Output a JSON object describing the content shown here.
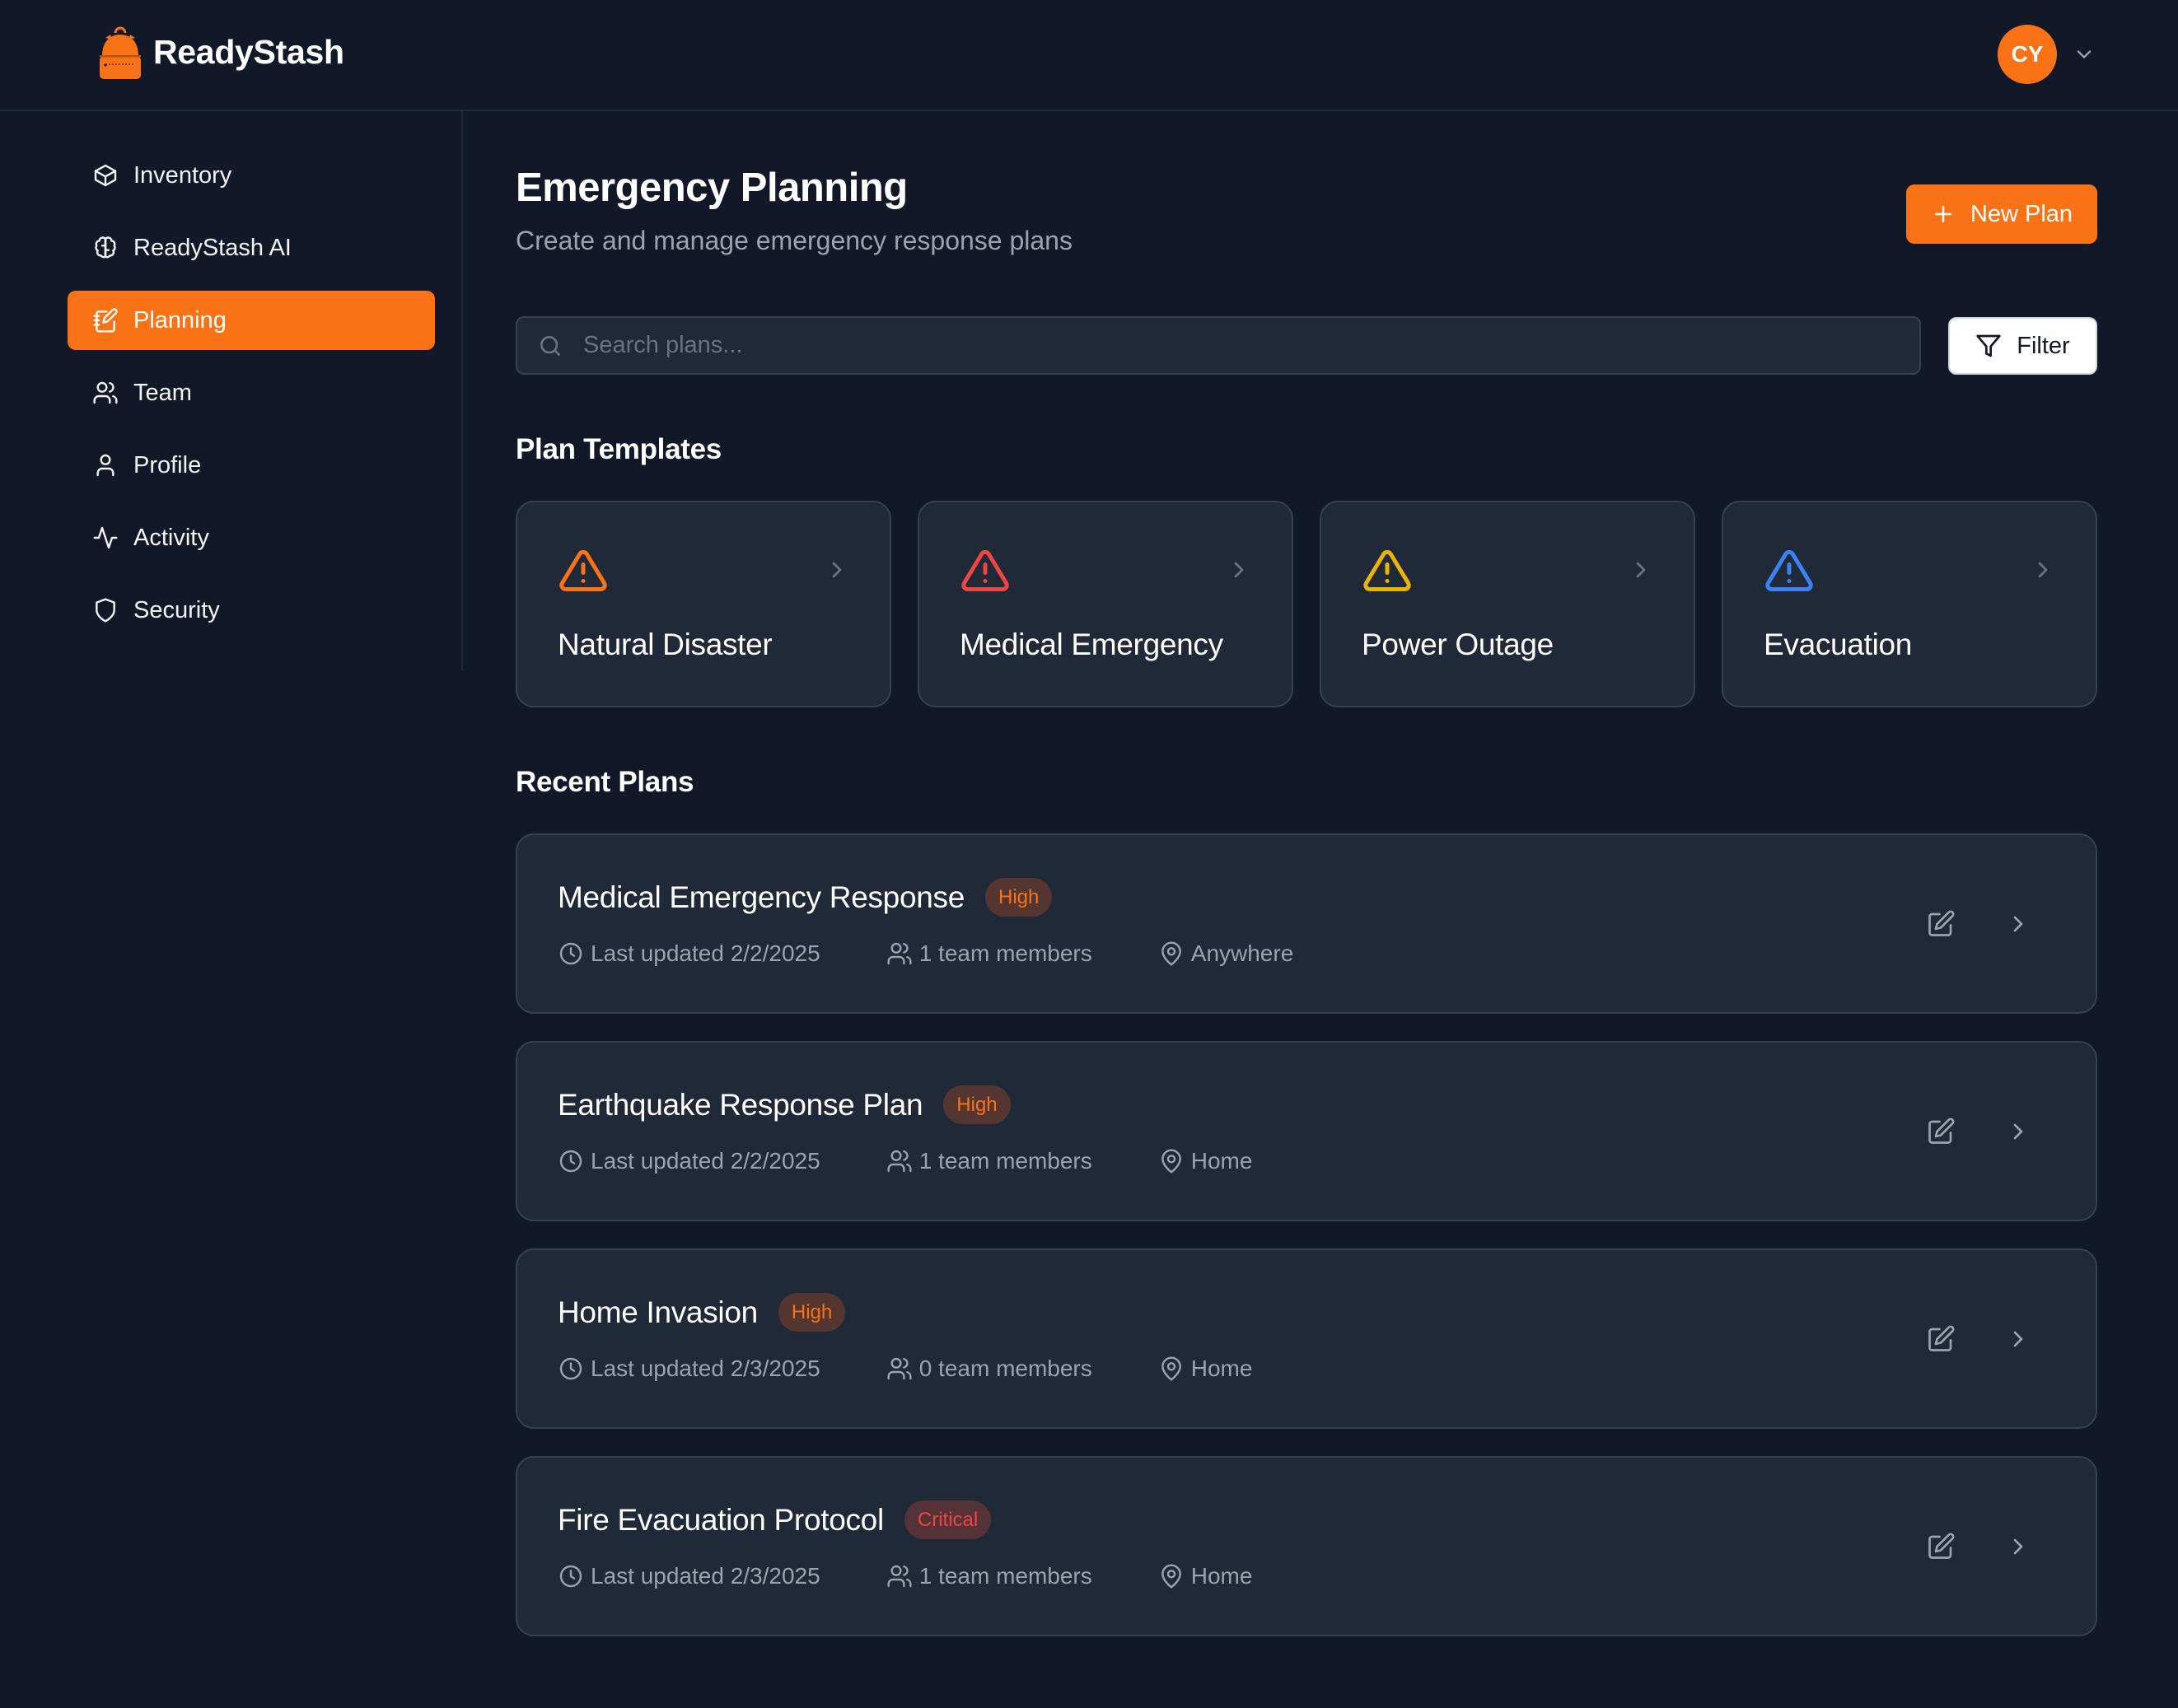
{
  "app": {
    "name": "ReadyStash",
    "logo_icon": "backpack-icon",
    "brand_color": "#f97316"
  },
  "user": {
    "initials": "CY",
    "menu_icon": "chevron-down-icon"
  },
  "sidebar": {
    "items": [
      {
        "label": "Inventory",
        "icon": "package-icon",
        "active": false
      },
      {
        "label": "ReadyStash AI",
        "icon": "brain-icon",
        "active": false
      },
      {
        "label": "Planning",
        "icon": "notebook-pen-icon",
        "active": true
      },
      {
        "label": "Team",
        "icon": "users-icon",
        "active": false
      },
      {
        "label": "Profile",
        "icon": "user-icon",
        "active": false
      },
      {
        "label": "Activity",
        "icon": "activity-icon",
        "active": false
      },
      {
        "label": "Security",
        "icon": "shield-icon",
        "active": false
      }
    ]
  },
  "main": {
    "title": "Emergency Planning",
    "subtitle": "Create and manage emergency response plans",
    "new_plan_label": "New Plan",
    "search": {
      "placeholder": "Search plans...",
      "value": ""
    },
    "filter_label": "Filter",
    "templates_heading": "Plan Templates",
    "templates": [
      {
        "label": "Natural Disaster",
        "icon": "alert-triangle-icon",
        "color": "#f97316"
      },
      {
        "label": "Medical Emergency",
        "icon": "alert-triangle-icon",
        "color": "#ef4444"
      },
      {
        "label": "Power Outage",
        "icon": "alert-triangle-icon",
        "color": "#eab308"
      },
      {
        "label": "Evacuation",
        "icon": "alert-triangle-icon",
        "color": "#3b82f6"
      }
    ],
    "recent_heading": "Recent Plans",
    "plans": [
      {
        "title": "Medical Emergency Response",
        "priority": "High",
        "priority_level": "high",
        "updated": "Last updated 2/2/2025",
        "members": "1 team members",
        "location": "Anywhere"
      },
      {
        "title": "Earthquake Response Plan",
        "priority": "High",
        "priority_level": "high",
        "updated": "Last updated 2/2/2025",
        "members": "1 team members",
        "location": "Home"
      },
      {
        "title": "Home Invasion",
        "priority": "High",
        "priority_level": "high",
        "updated": "Last updated 2/3/2025",
        "members": "0 team members",
        "location": "Home"
      },
      {
        "title": "Fire Evacuation Protocol",
        "priority": "Critical",
        "priority_level": "critical",
        "updated": "Last updated 2/3/2025",
        "members": "1 team members",
        "location": "Home"
      }
    ]
  }
}
